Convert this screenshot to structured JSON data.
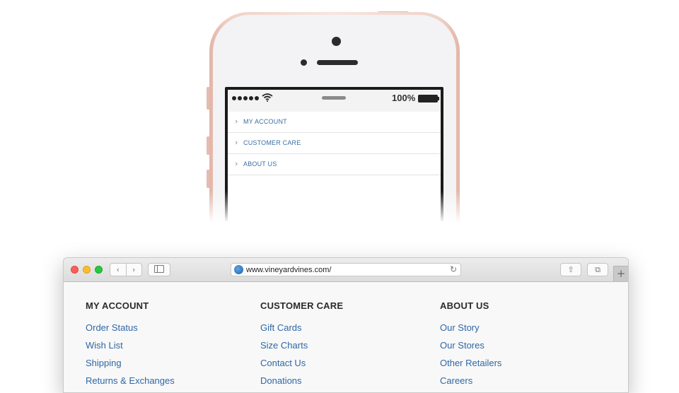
{
  "phone": {
    "status": {
      "battery_text": "100%"
    },
    "menu": [
      {
        "label": "MY ACCOUNT"
      },
      {
        "label": "CUSTOMER CARE"
      },
      {
        "label": "ABOUT US"
      }
    ]
  },
  "browser": {
    "url": "www.vineyardvines.com/",
    "nav_back_glyph": "‹",
    "nav_forward_glyph": "›",
    "reload_glyph": "↻",
    "share_glyph": "⇧",
    "tabs_glyph": "⧉",
    "newtab_glyph": "+",
    "columns": [
      {
        "heading": "MY ACCOUNT",
        "links": [
          "Order Status",
          "Wish List",
          "Shipping",
          "Returns & Exchanges"
        ]
      },
      {
        "heading": "CUSTOMER CARE",
        "links": [
          "Gift Cards",
          "Size Charts",
          "Contact Us",
          "Donations"
        ]
      },
      {
        "heading": "ABOUT US",
        "links": [
          "Our Story",
          "Our Stores",
          "Other Retailers",
          "Careers"
        ]
      }
    ]
  },
  "colors": {
    "link": "#2f67a5",
    "phone_rose_gold": "#e2b5a8",
    "traffic_red": "#fc5f57",
    "traffic_yellow": "#fdbc2e",
    "traffic_green": "#28c840"
  },
  "icons": [
    "wifi-icon",
    "battery-icon",
    "chevron-right-icon",
    "globe-icon",
    "reload-icon",
    "share-icon",
    "tabs-icon",
    "sidebar-icon",
    "plus-icon"
  ]
}
